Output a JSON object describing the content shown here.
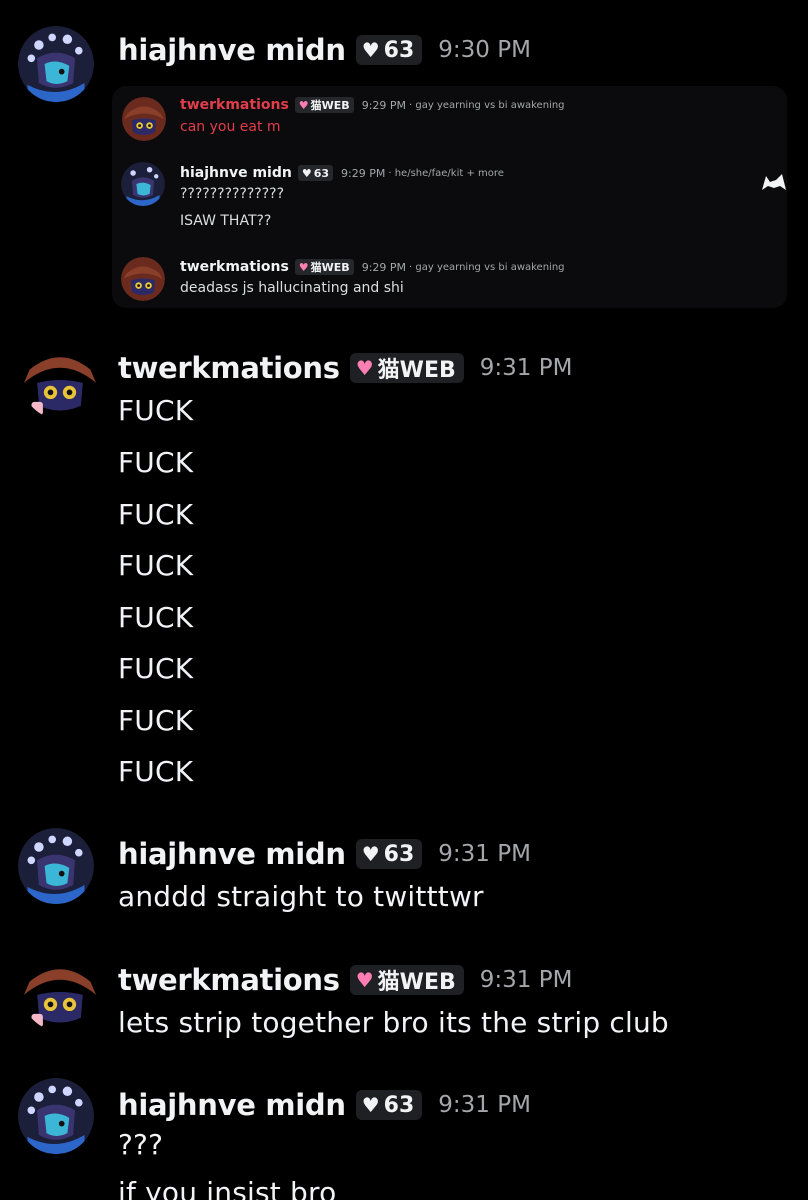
{
  "forwarded": {
    "messages": [
      {
        "user": "twerkmations",
        "tag": "猫WEB",
        "time": "9:29 PM",
        "pronouns": "gay yearning vs bi awakening",
        "lines": [
          "can you eat m"
        ]
      },
      {
        "user": "hiajhnve midn",
        "tag": "63",
        "time": "9:29 PM",
        "pronouns": "he/she/fae/kit + more",
        "lines": [
          "??????????????",
          "ISAW THAT??"
        ]
      },
      {
        "user": "twerkmations",
        "tag": "猫WEB",
        "time": "9:29 PM",
        "pronouns": "gay yearning vs bi awakening",
        "lines": [
          "deadass js hallucinating and shi"
        ]
      }
    ]
  },
  "messages": [
    {
      "user": "hiajhnve midn",
      "tag": "63",
      "time": "9:30 PM",
      "lines": []
    },
    {
      "user": "twerkmations",
      "tag": "猫WEB",
      "time": "9:31 PM",
      "lines": [
        "FUCK",
        "FUCK",
        "FUCK",
        "FUCK",
        "FUCK",
        "FUCK",
        "FUCK",
        "FUCK"
      ]
    },
    {
      "user": "hiajhnve midn",
      "tag": "63",
      "time": "9:31 PM",
      "lines": [
        "anddd straight to twitttwr"
      ]
    },
    {
      "user": "twerkmations",
      "tag": "猫WEB",
      "time": "9:31 PM",
      "lines": [
        "lets strip together bro its the strip club"
      ]
    },
    {
      "user": "hiajhnve midn",
      "tag": "63",
      "time": "9:31 PM",
      "lines": [
        "???",
        "if you insist bro"
      ]
    }
  ],
  "icons": {
    "heart_white": "white-heart-icon",
    "heart_pink": "pink-heart-icon",
    "corner": "cat-icon"
  },
  "colors": {
    "background": "#000000",
    "username": "#f2f3f5",
    "timestamp": "#a3a6aa",
    "reply_username": "#e23d4a",
    "heart_pink": "#ff7eb3"
  }
}
